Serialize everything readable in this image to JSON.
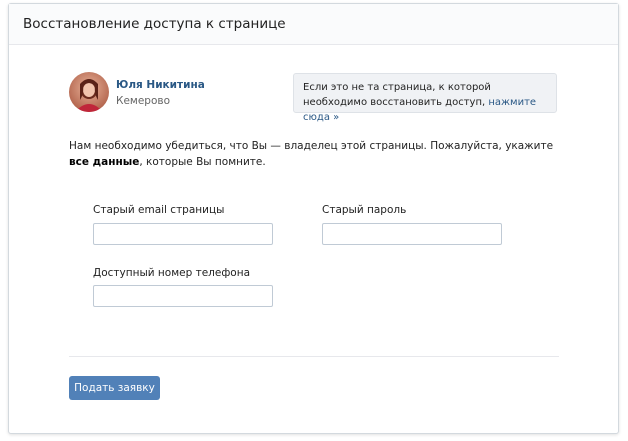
{
  "header": {
    "title": "Восстановление доступа к странице"
  },
  "profile": {
    "name": "Юля Никитина",
    "city": "Кемерово",
    "avatar_icon": "user-photo"
  },
  "notice": {
    "text": "Если это не та страница, к которой необходимо восстановить доступ,",
    "link": "нажмите сюда »"
  },
  "intro": {
    "text_before": "Нам необходимо убедиться, что Вы — владелец этой страницы. Пожалуйста, укажите ",
    "bold": "все данные",
    "text_after": ", которые Вы помните."
  },
  "form": {
    "email_label": "Старый email страницы",
    "email_value": "",
    "password_label": "Старый пароль",
    "password_value": "",
    "phone_label": "Доступный номер телефона",
    "phone_value": ""
  },
  "submit_label": "Подать заявку",
  "colors": {
    "accent": "#5181b8",
    "link": "#2a5885",
    "header_bg": "#fafbfc",
    "notice_bg": "#f0f2f5",
    "border": "#d3d9de"
  }
}
